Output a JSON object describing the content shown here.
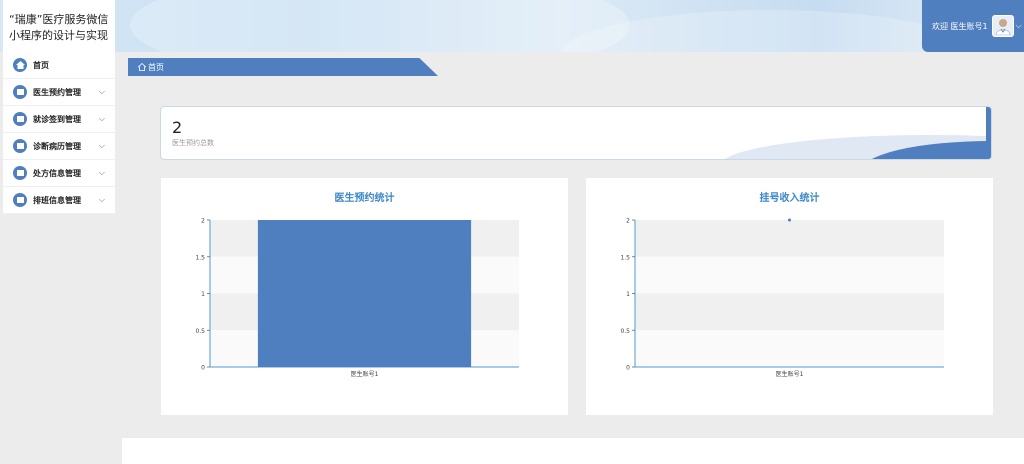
{
  "app": {
    "title": "“瑞康”医疗服务微信小程序的设计与实现"
  },
  "header": {
    "welcome": "欢迎 医生账号1",
    "avatar_icon": "doctor-avatar-icon",
    "caret": "⌵"
  },
  "sidebar": {
    "items": [
      {
        "label": "首页",
        "icon": "home-icon",
        "has_submenu": false
      },
      {
        "label": "医生预约管理",
        "icon": "appointment-icon",
        "has_submenu": true
      },
      {
        "label": "就诊签到管理",
        "icon": "checkin-icon",
        "has_submenu": true
      },
      {
        "label": "诊断病历管理",
        "icon": "record-icon",
        "has_submenu": true
      },
      {
        "label": "处方信息管理",
        "icon": "prescription-icon",
        "has_submenu": true
      },
      {
        "label": "排班信息管理",
        "icon": "schedule-icon",
        "has_submenu": true
      }
    ],
    "chevron": "⌵"
  },
  "breadcrumb": {
    "home": "首页"
  },
  "stat_card": {
    "value": "2",
    "label": "医生预约总数"
  },
  "colors": {
    "accent": "#4f7fbf",
    "title_blue": "#3a86c8"
  },
  "chart_data": [
    {
      "type": "bar",
      "title": "医生预约统计",
      "categories": [
        "医生账号1"
      ],
      "series": [
        {
          "values": [
            2
          ]
        }
      ],
      "ylim": [
        0,
        2
      ],
      "yticks": [
        "0",
        "0.5",
        "1",
        "1.5",
        "2"
      ],
      "grid": true,
      "color": "#4f7fbf"
    },
    {
      "type": "line",
      "title": "挂号收入统计",
      "categories": [
        "医生账号1"
      ],
      "series": [
        {
          "values": [
            2
          ]
        }
      ],
      "ylim": [
        0,
        2
      ],
      "yticks": [
        "0",
        "0.5",
        "1",
        "1.5",
        "2"
      ],
      "grid": true,
      "color": "#4f7fbf"
    }
  ]
}
